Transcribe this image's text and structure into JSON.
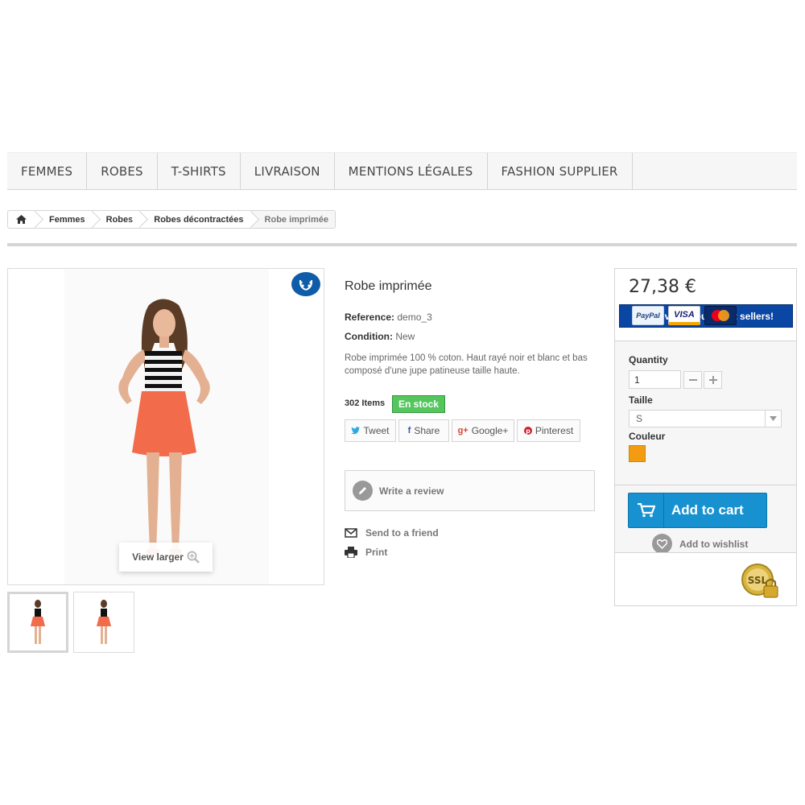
{
  "nav": {
    "items": [
      "FEMMES",
      "ROBES",
      "T-SHIRTS",
      "LIVRAISON",
      "MENTIONS LÉGALES",
      "FASHION SUPPLIER"
    ]
  },
  "breadcrumb": {
    "home_icon": "home-icon",
    "items": [
      "Femmes",
      "Robes",
      "Robes décontractées"
    ],
    "current": "Robe imprimée"
  },
  "image": {
    "view_larger": "View larger",
    "badge_icon": "laurel-icon"
  },
  "product": {
    "title": "Robe imprimée",
    "reference_label": "Reference:",
    "reference": "demo_3",
    "condition_label": "Condition:",
    "condition": "New",
    "description": "Robe imprimée 100 % coton. Haut rayé noir et blanc et bas composé d'une jupe patineuse taille haute.",
    "quantity_text": "302 Items",
    "stock": "En stock"
  },
  "social": {
    "tweet": "Tweet",
    "share": "Share",
    "google": "Google+",
    "pinterest": "Pinterest"
  },
  "review": {
    "label": "Write a review"
  },
  "links": {
    "send_friend": "Send to a friend",
    "print": "Print"
  },
  "buy": {
    "price": "27,38 €",
    "discover": "Discover all our great sellers!",
    "quantity_label": "Quantity",
    "quantity_value": "1",
    "size_label": "Taille",
    "size_value": "S",
    "color_label": "Couleur",
    "color_swatch": "#f39c11",
    "add_to_cart": "Add to cart",
    "wishlist": "Add to wishlist"
  },
  "payments": {
    "paypal": "PayPal",
    "visa": "VISA",
    "mastercard": "MasterCard",
    "ssl": "SSL"
  },
  "colors": {
    "accent_blue": "#1891d1",
    "discover_blue": "#0a46a3",
    "stock_green": "#55c65e"
  }
}
